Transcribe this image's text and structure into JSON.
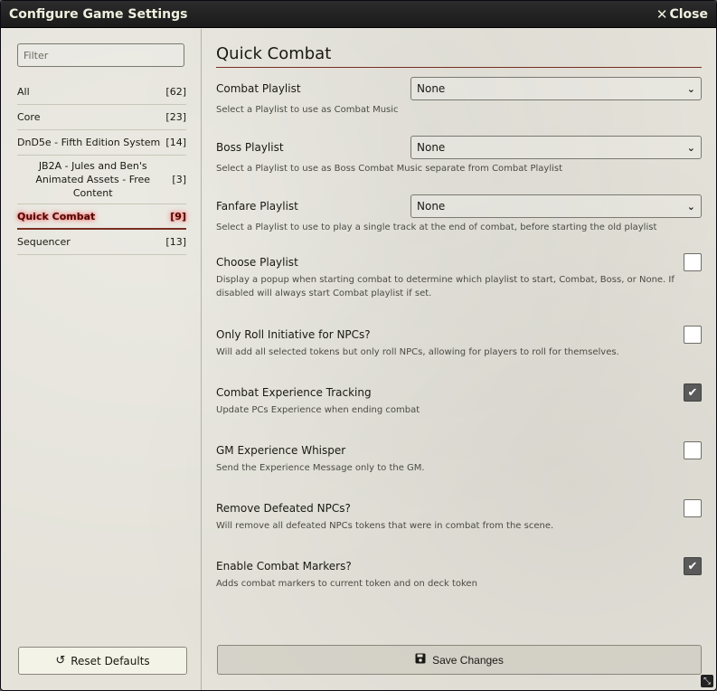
{
  "window": {
    "title": "Configure Game Settings",
    "close_label": "Close"
  },
  "sidebar": {
    "filter_placeholder": "Filter",
    "categories": [
      {
        "name": "All",
        "count": "[62]"
      },
      {
        "name": "Core",
        "count": "[23]"
      },
      {
        "name": "DnD5e - Fifth Edition System",
        "count": "[14]"
      },
      {
        "name": "JB2A - Jules and Ben's Animated Assets - Free Content",
        "count": "[3]"
      },
      {
        "name": "Quick Combat",
        "count": "[9]"
      },
      {
        "name": "Sequencer",
        "count": "[13]"
      }
    ],
    "active_category": "Quick Combat",
    "reset_label": "Reset Defaults"
  },
  "main": {
    "section_title": "Quick Combat",
    "settings": [
      {
        "label": "Combat Playlist",
        "type": "select",
        "value": "None",
        "hint": "Select a Playlist to use as Combat Music"
      },
      {
        "label": "Boss Playlist",
        "type": "select",
        "value": "None",
        "hint": "Select a Playlist to use as Boss Combat Music separate from Combat Playlist"
      },
      {
        "label": "Fanfare Playlist",
        "type": "select",
        "value": "None",
        "hint": "Select a Playlist to use to play a single track at the end of combat, before starting the old playlist"
      },
      {
        "label": "Choose Playlist",
        "type": "checkbox",
        "checked": false,
        "hint": "Display a popup when starting combat to determine which playlist to start, Combat, Boss, or None. If disabled will always start Combat playlist if set."
      },
      {
        "label": "Only Roll Initiative for NPCs?",
        "type": "checkbox",
        "checked": false,
        "hint": "Will add all selected tokens but only roll NPCs, allowing for players to roll for themselves."
      },
      {
        "label": "Combat Experience Tracking",
        "type": "checkbox",
        "checked": true,
        "hint": "Update PCs Experience when ending combat"
      },
      {
        "label": "GM Experience Whisper",
        "type": "checkbox",
        "checked": false,
        "hint": "Send the Experience Message only to the GM."
      },
      {
        "label": "Remove Defeated NPCs?",
        "type": "checkbox",
        "checked": false,
        "hint": "Will remove all defeated NPCs tokens that were in combat from the scene."
      },
      {
        "label": "Enable Combat Markers?",
        "type": "checkbox",
        "checked": true,
        "hint": "Adds combat markers to current token and on deck token"
      }
    ],
    "save_label": "Save Changes"
  },
  "icons": {
    "close": "close-icon",
    "reset": "undo-icon",
    "save": "floppy-disk-icon",
    "chevron": "chevron-down-icon",
    "check": "checkmark-icon",
    "resize": "resize-icon"
  },
  "colors": {
    "accent": "#782e22",
    "titlebar": "#1a1a1a",
    "background": "#e4e2d9"
  }
}
